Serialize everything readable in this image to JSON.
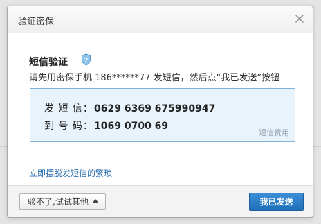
{
  "dialog": {
    "title": "验证密保",
    "close_icon": "close-icon"
  },
  "verification": {
    "heading": "短信验证",
    "heading_icon": "shield-question-icon",
    "instruction": "请先用密保手机 186******77 发短信，然后点“我已发送”按钮"
  },
  "sms": {
    "send_label": "发 短 信：",
    "send_content": "0629 6369 675990947",
    "to_label": "到 号 码：",
    "to_number": "1069 0700 69",
    "fee_note": "短信费用"
  },
  "links": {
    "escape": "立即摆脱发短信的繁琐"
  },
  "footer": {
    "other_option": "验不了,试试其他",
    "confirm": "我已发送"
  },
  "colors": {
    "primary_button": "#2a7cc7",
    "link": "#2a6fb0",
    "box_background": "#e8f3fb",
    "box_border": "#7fb3dc"
  }
}
